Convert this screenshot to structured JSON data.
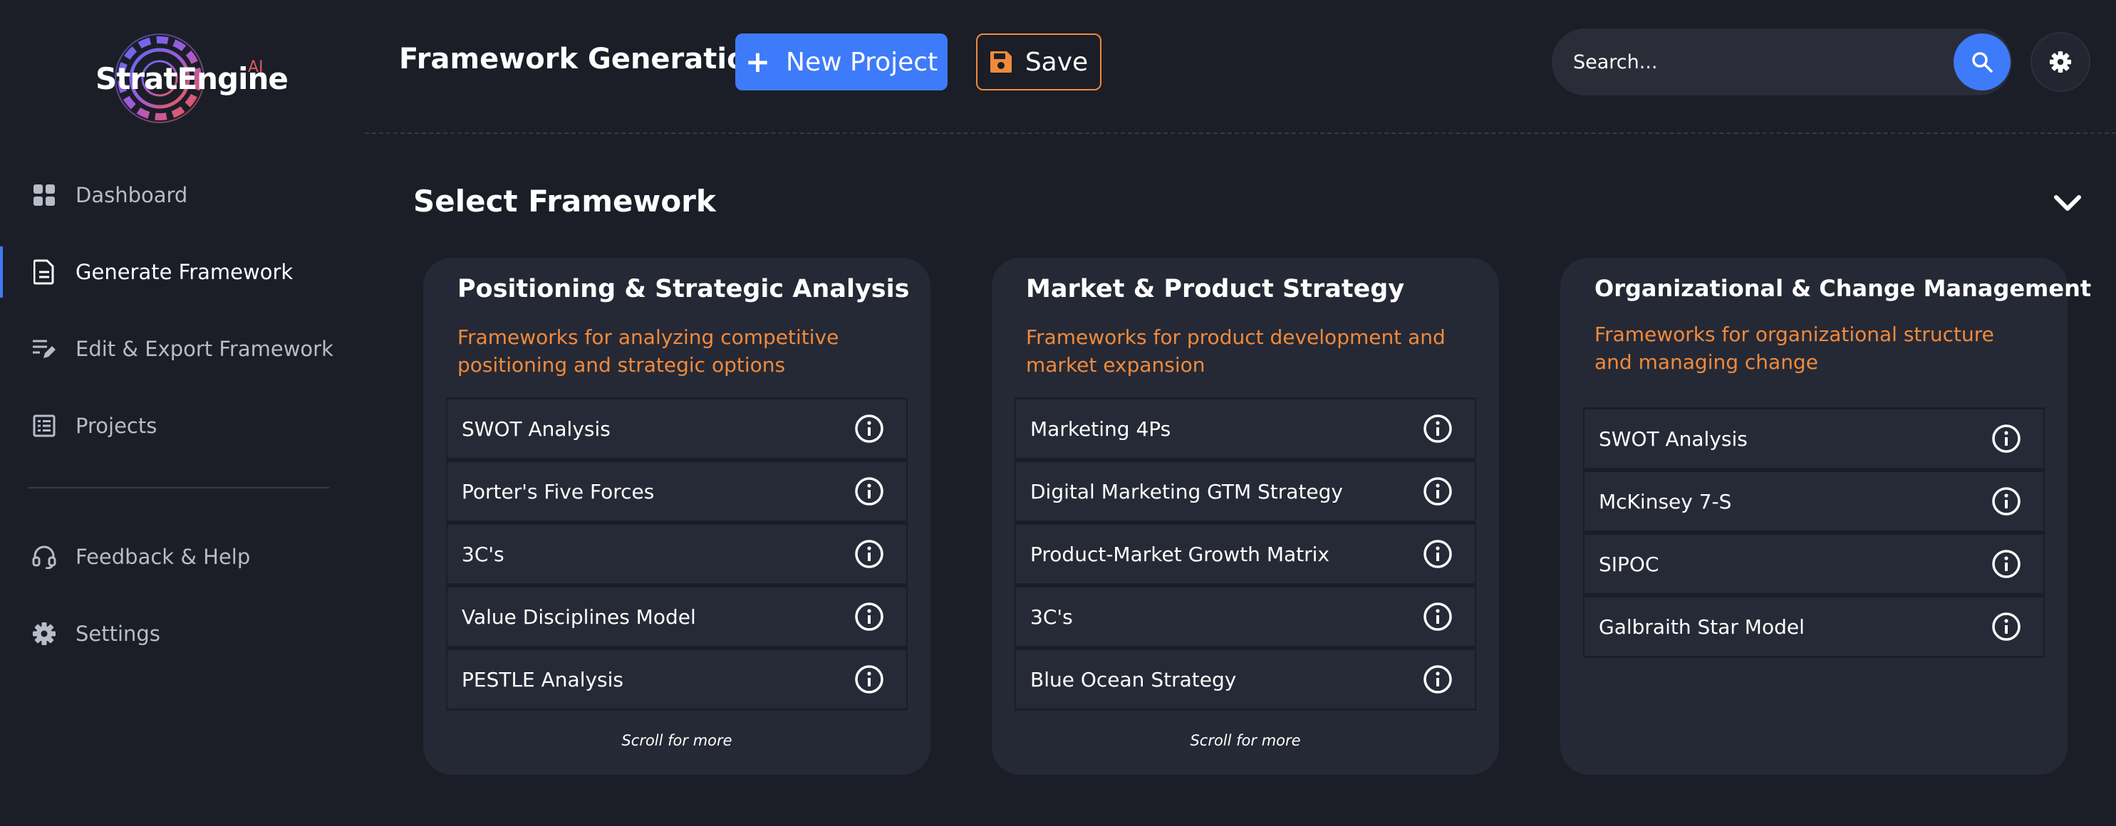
{
  "brand": {
    "name": "StratEngine",
    "suffix": "AI"
  },
  "sidebar": {
    "items": [
      {
        "label": "Dashboard",
        "icon": "grid-icon"
      },
      {
        "label": "Generate Framework",
        "icon": "document-icon"
      },
      {
        "label": "Edit & Export Framework",
        "icon": "edit-list-icon"
      },
      {
        "label": "Projects",
        "icon": "list-icon"
      }
    ],
    "secondary": [
      {
        "label": "Feedback & Help",
        "icon": "headset-icon"
      },
      {
        "label": "Settings",
        "icon": "gear-icon"
      }
    ]
  },
  "header": {
    "title": "Framework Generation",
    "new_project_label": "New Project",
    "save_label": "Save",
    "search_placeholder": "Search..."
  },
  "main": {
    "section_title": "Select Framework",
    "cards": [
      {
        "title": "Positioning & Strategic Analysis",
        "description": "Frameworks for analyzing competitive positioning and strategic options",
        "items": [
          "SWOT Analysis",
          "Porter's Five Forces",
          "3C's",
          "Value Disciplines Model",
          "PESTLE Analysis"
        ],
        "scroll_hint": "Scroll for more"
      },
      {
        "title": "Market & Product Strategy",
        "description": "Frameworks for product development and market expansion",
        "items": [
          "Marketing 4Ps",
          "Digital Marketing GTM Strategy",
          "Product-Market Growth Matrix",
          "3C's",
          "Blue Ocean Strategy"
        ],
        "scroll_hint": "Scroll for more"
      },
      {
        "title": "Organizational & Change Management",
        "description": "Frameworks for organizational structure and managing change",
        "items": [
          "SWOT Analysis",
          "McKinsey 7-S",
          "SIPOC",
          "Galbraith Star Model"
        ]
      }
    ]
  },
  "colors": {
    "background": "#1b1e27",
    "card": "#252935",
    "accent_blue": "#3e7bfa",
    "accent_orange": "#f08a3c"
  }
}
